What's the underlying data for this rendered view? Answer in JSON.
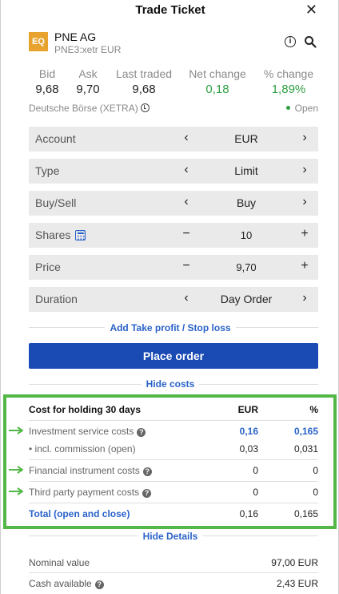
{
  "header": {
    "title": "Trade Ticket",
    "close": "✕"
  },
  "instrument": {
    "badge": "EQ",
    "name": "PNE AG",
    "sub": "PNE3:xetr EUR",
    "accent": "#e8a32f"
  },
  "quotes": [
    {
      "label": "Bid",
      "value": "9,68"
    },
    {
      "label": "Ask",
      "value": "9,70"
    },
    {
      "label": "Last traded",
      "value": "9,68"
    },
    {
      "label": "Net change",
      "value": "0,18"
    },
    {
      "label": "% change",
      "value": "1,89%"
    }
  ],
  "exchange": {
    "name": "Deutsche Börse (XETRA)",
    "status": "Open"
  },
  "form": {
    "account": {
      "label": "Account",
      "value": "EUR"
    },
    "type": {
      "label": "Type",
      "value": "Limit"
    },
    "side": {
      "label": "Buy/Sell",
      "value": "Buy"
    },
    "shares": {
      "label": "Shares",
      "value": "10"
    },
    "price": {
      "label": "Price",
      "value": "9,70"
    },
    "duration": {
      "label": "Duration",
      "value": "Day Order"
    }
  },
  "actions": {
    "tp_sl": "Add Take profit / Stop loss",
    "place_order": "Place order",
    "hide_costs": "Hide costs",
    "hide_details": "Hide Details"
  },
  "costs": {
    "header": {
      "label": "Cost for holding 30 days",
      "eur": "EUR",
      "pct": "%"
    },
    "rows": [
      {
        "label": "Investment service costs",
        "eur": "0,16",
        "pct": "0,165"
      },
      {
        "label": "• incl. commission (open)",
        "eur": "0,03",
        "pct": "0,031"
      },
      {
        "label": "Financial instrument costs",
        "eur": "0",
        "pct": "0"
      },
      {
        "label": "Third party payment costs",
        "eur": "0",
        "pct": "0"
      }
    ],
    "total": {
      "label": "Total (open and close)",
      "eur": "0,16",
      "pct": "0,165"
    }
  },
  "details": [
    {
      "label": "Nominal value",
      "value": "97,00 EUR"
    },
    {
      "label": "Cash available",
      "value": "2,43 EUR"
    }
  ],
  "colors": {
    "positive": "#2ea043",
    "link": "#2a62c9",
    "primary_button": "#1a4bb5",
    "highlight_border": "#54b848"
  },
  "icons": {
    "close": "close-icon",
    "info": "info-icon",
    "search": "search-icon",
    "clock": "clock-icon",
    "calculator": "calculator-icon",
    "help": "question-icon",
    "arrow": "arrow-right-icon"
  }
}
